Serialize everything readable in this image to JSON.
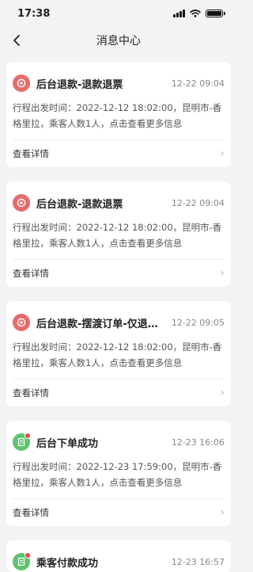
{
  "status_bar": {
    "time": "17:38"
  },
  "nav": {
    "title": "消息中心"
  },
  "messages": [
    {
      "title": "后台退款-退款退票",
      "time": "12-22 09:04",
      "body": "行程出发时间：2022-12-12 18:02:00，昆明市-香格里拉，乘客人数1人，点击查看更多信息",
      "action": "查看详情",
      "icon": "refund-icon",
      "color": "#e46c6c"
    },
    {
      "title": "后台退款-退款退票",
      "time": "12-22 09:04",
      "body": "行程出发时间：2022-12-12 18:02:00，昆明市-香格里拉，乘客人数1人，点击查看更多信息",
      "action": "查看详情",
      "icon": "refund-icon",
      "color": "#e46c6c"
    },
    {
      "title": "后台退款-摆渡订单-仅退接...",
      "time": "12-22 09:05",
      "body": "行程出发时间：2022-12-12 18:02:00，昆明市-香格里拉，乘客人数1人，点击查看更多信息",
      "action": "查看详情",
      "icon": "refund-icon",
      "color": "#e46c6c"
    },
    {
      "title": "后台下单成功",
      "time": "12-23 16:06",
      "body": "行程出发时间：2022-12-23 17:59:00，昆明市-香格里拉，乘客人数1人，点击查看更多信息",
      "action": "查看详情",
      "icon": "order-icon",
      "color": "#5cc46e"
    },
    {
      "title": "乘客付款成功",
      "time": "12-23 16:57",
      "body": "",
      "action": "",
      "icon": "order-icon",
      "color": "#5cc46e"
    }
  ]
}
